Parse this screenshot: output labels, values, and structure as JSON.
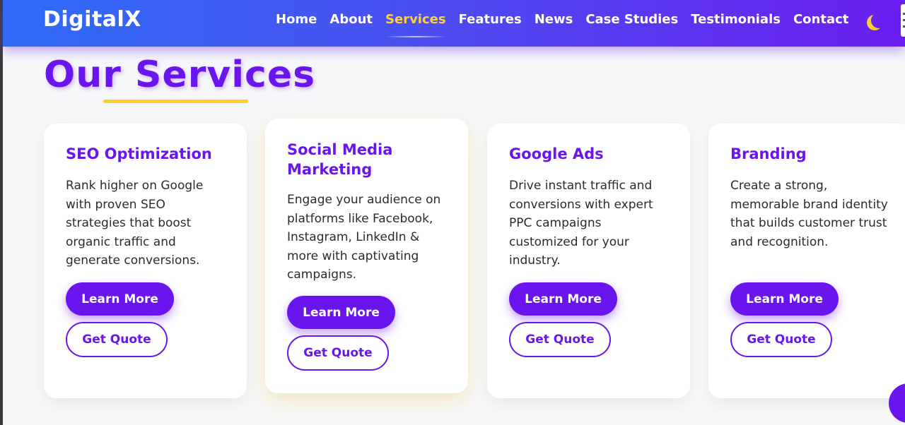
{
  "brand": {
    "logo": "DigitalX"
  },
  "nav": {
    "links": [
      {
        "label": "Home"
      },
      {
        "label": "About"
      },
      {
        "label": "Services"
      },
      {
        "label": "Features"
      },
      {
        "label": "News"
      },
      {
        "label": "Case Studies"
      },
      {
        "label": "Testimonials"
      },
      {
        "label": "Contact"
      }
    ],
    "active": "Services",
    "theme_toggle_icon": "moon-icon"
  },
  "colors": {
    "primary": "#6a14ee",
    "accent": "#ffcc33",
    "nav_gradient_start": "#2e6cf6",
    "nav_gradient_end": "#6a1ef0"
  },
  "section": {
    "title": "Our Services"
  },
  "services": [
    {
      "title": "SEO Optimization",
      "description": "Rank higher on Google with proven SEO strategies that boost organic traffic and generate conversions.",
      "learn_more": "Learn More",
      "get_quote": "Get Quote"
    },
    {
      "title": "Social Media Marketing",
      "description": "Engage your audience on platforms like Facebook, Instagram, LinkedIn & more with captivating campaigns.",
      "learn_more": "Learn More",
      "get_quote": "Get Quote"
    },
    {
      "title": "Google Ads",
      "description": "Drive instant traffic and conversions with expert PPC campaigns customized for your industry.",
      "learn_more": "Learn More",
      "get_quote": "Get Quote"
    },
    {
      "title": "Branding",
      "description": "Create a strong, memorable brand identity that builds customer trust and recognition.",
      "learn_more": "Learn More",
      "get_quote": "Get Quote"
    }
  ]
}
